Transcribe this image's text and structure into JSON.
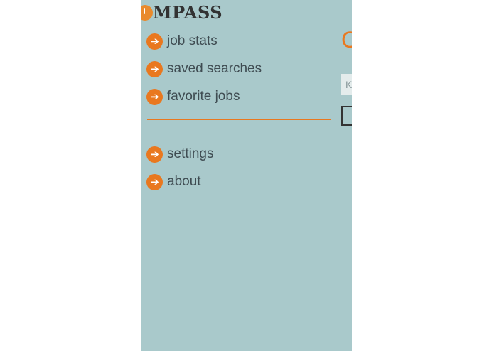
{
  "app": {
    "brand_text": "MPASS",
    "brand_logo_icon": "compass-logo-icon",
    "accent_color": "#e9781f",
    "panel_background": "#a9c9cb"
  },
  "menu": {
    "items": [
      {
        "label": "job stats",
        "icon": "arrow-right-icon"
      },
      {
        "label": "saved searches",
        "icon": "arrow-right-icon"
      },
      {
        "label": "favorite jobs",
        "icon": "arrow-right-icon"
      },
      {
        "label": "settings",
        "icon": "arrow-right-icon"
      },
      {
        "label": "about",
        "icon": "arrow-right-icon"
      }
    ]
  },
  "peek": {
    "title_fragment": "C",
    "input_fragment": "K"
  }
}
